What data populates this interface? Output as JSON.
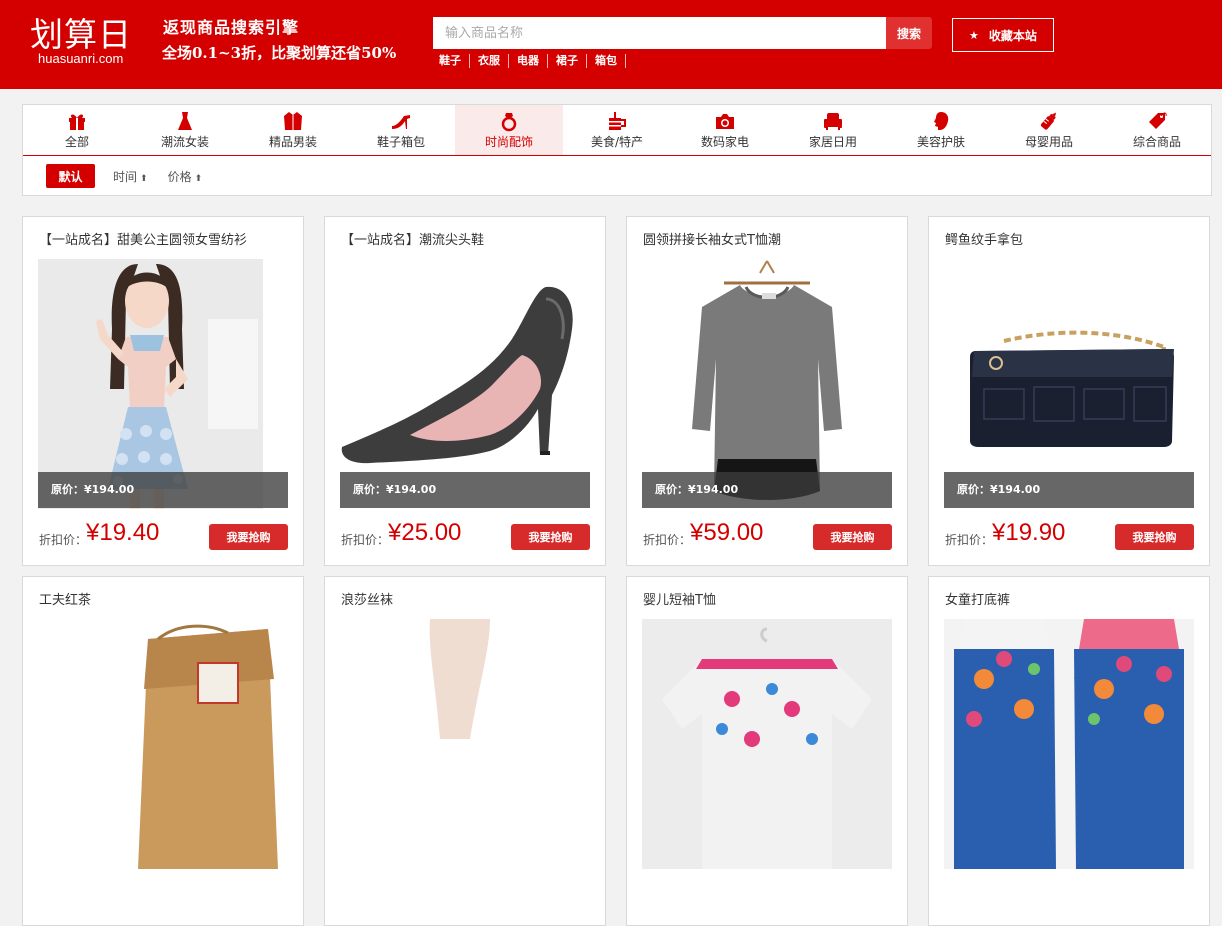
{
  "header": {
    "logo_cn": "划算日",
    "logo_en": "huasuanri.com",
    "slogan_line1": "返现商品搜索引擎",
    "slogan_line2": "全场0.1~3折，比聚划算还省50%",
    "search": {
      "placeholder": "输入商品名称",
      "button": "搜索"
    },
    "hot_words": [
      "鞋子",
      "衣服",
      "电器",
      "裙子",
      "箱包"
    ],
    "favorite_label": "收藏本站"
  },
  "categories": [
    {
      "label": "全部",
      "icon": "gift-icon"
    },
    {
      "label": "潮流女装",
      "icon": "dress-icon"
    },
    {
      "label": "精品男装",
      "icon": "jacket-icon"
    },
    {
      "label": "鞋子箱包",
      "icon": "high-heel-icon"
    },
    {
      "label": "时尚配饰",
      "icon": "ring-icon",
      "active": true
    },
    {
      "label": "美食/特产",
      "icon": "drink-icon"
    },
    {
      "label": "数码家电",
      "icon": "camera-icon"
    },
    {
      "label": "家居日用",
      "icon": "armchair-icon"
    },
    {
      "label": "美容护肤",
      "icon": "face-icon"
    },
    {
      "label": "母婴用品",
      "icon": "baby-bottle-icon"
    },
    {
      "label": "综合商品",
      "icon": "tag-icon"
    }
  ],
  "sort": {
    "default": "默认",
    "time": "时间",
    "price": "价格",
    "arrow": "⬆"
  },
  "products": [
    {
      "title": "【一站成名】甜美公主圆领女雪纺衫",
      "original": "原价：¥194.00",
      "discount_label": "折扣价：",
      "price": "¥19.40",
      "buy": "我要抢购"
    },
    {
      "title": "【一站成名】潮流尖头鞋",
      "original": "原价：¥194.00",
      "discount_label": "折扣价：",
      "price": "¥25.00",
      "buy": "我要抢购"
    },
    {
      "title": "圆领拼接长袖女式T恤潮",
      "original": "原价：¥194.00",
      "discount_label": "折扣价：",
      "price": "¥59.00",
      "buy": "我要抢购"
    },
    {
      "title": "鳄鱼纹手拿包",
      "original": "原价：¥194.00",
      "discount_label": "折扣价：",
      "price": "¥19.90",
      "buy": "我要抢购"
    },
    {
      "title": "工夫红茶"
    },
    {
      "title": "浪莎丝袜"
    },
    {
      "title": "婴儿短袖T恤"
    },
    {
      "title": "女童打底裤"
    }
  ],
  "colors": {
    "brand_red": "#d40000",
    "bar_gray": "#3c3c3c"
  }
}
